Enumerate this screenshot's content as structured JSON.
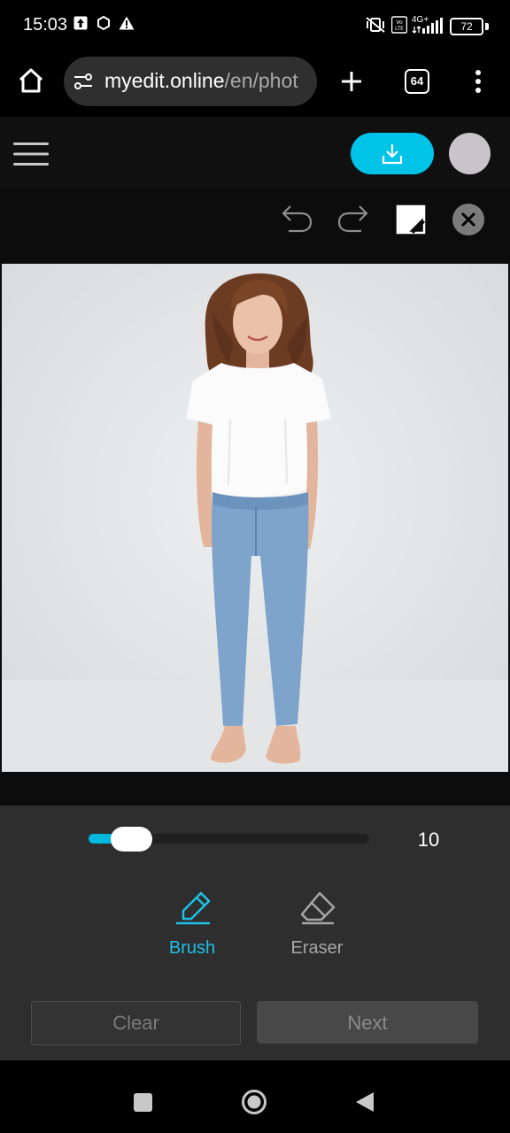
{
  "status_bar": {
    "time": "15:03",
    "battery": "72",
    "network": "4G+"
  },
  "browser": {
    "url_main": "myedit.online",
    "url_path": "/en/phot",
    "tab_count": "64"
  },
  "editor": {
    "brush_size": "10",
    "brush_size_fraction": 0.08,
    "tools": [
      {
        "label": "Brush",
        "active": true
      },
      {
        "label": "Eraser",
        "active": false
      }
    ],
    "clear_label": "Clear",
    "next_label": "Next"
  },
  "colors": {
    "accent": "#00c3e8",
    "panel_bg": "#2e2e2e",
    "active_tool": "#1ec0e6",
    "inactive_tool": "#a6a6a6"
  }
}
